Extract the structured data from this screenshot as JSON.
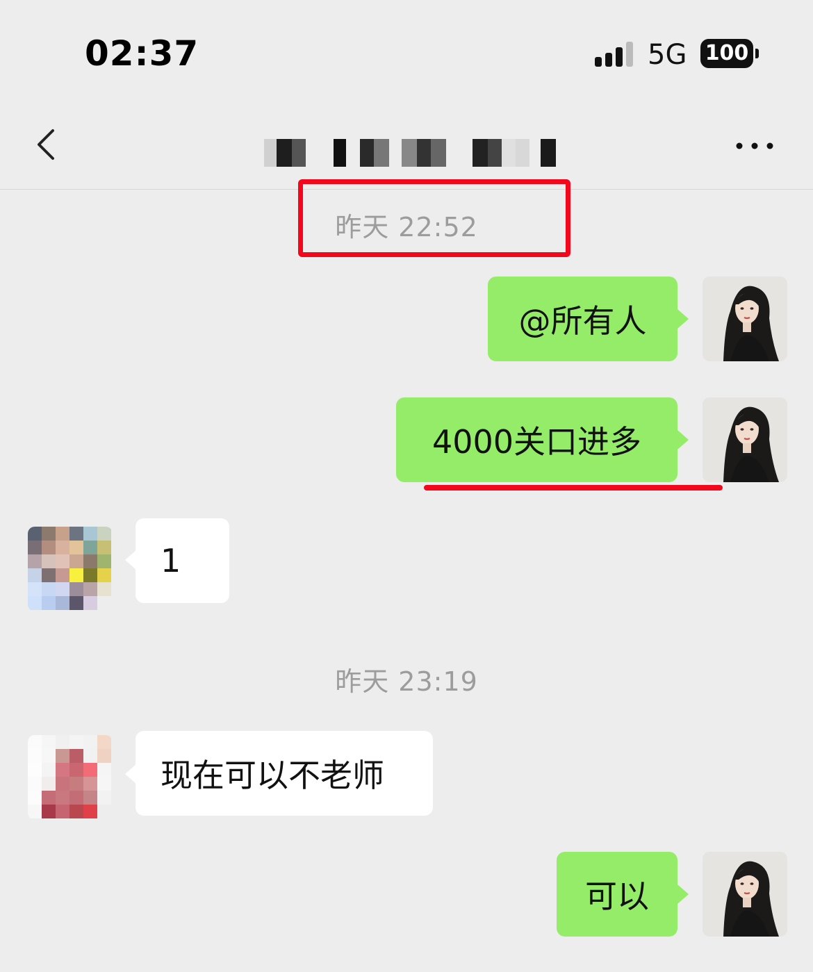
{
  "status_bar": {
    "time": "02:37",
    "network": "5G",
    "battery": "100"
  },
  "nav": {
    "title": ""
  },
  "messages": [
    {
      "type": "timestamp",
      "text": "昨天 22:52"
    },
    {
      "type": "sent",
      "text": "@所有人"
    },
    {
      "type": "sent",
      "text": "4000关口进多"
    },
    {
      "type": "received",
      "text": "1"
    },
    {
      "type": "timestamp",
      "text": "昨天 23:19"
    },
    {
      "type": "received",
      "text": "现在可以不老师"
    },
    {
      "type": "sent",
      "text": "可以"
    }
  ],
  "colors": {
    "background": "#ededed",
    "sent_bubble": "#95ec69",
    "received_bubble": "#ffffff",
    "annotation_red": "#f2071c",
    "timestamp_text": "#9c9c9c"
  },
  "icons": [
    "back-chevron-icon",
    "more-dots-icon",
    "signal-icon",
    "battery-icon"
  ]
}
